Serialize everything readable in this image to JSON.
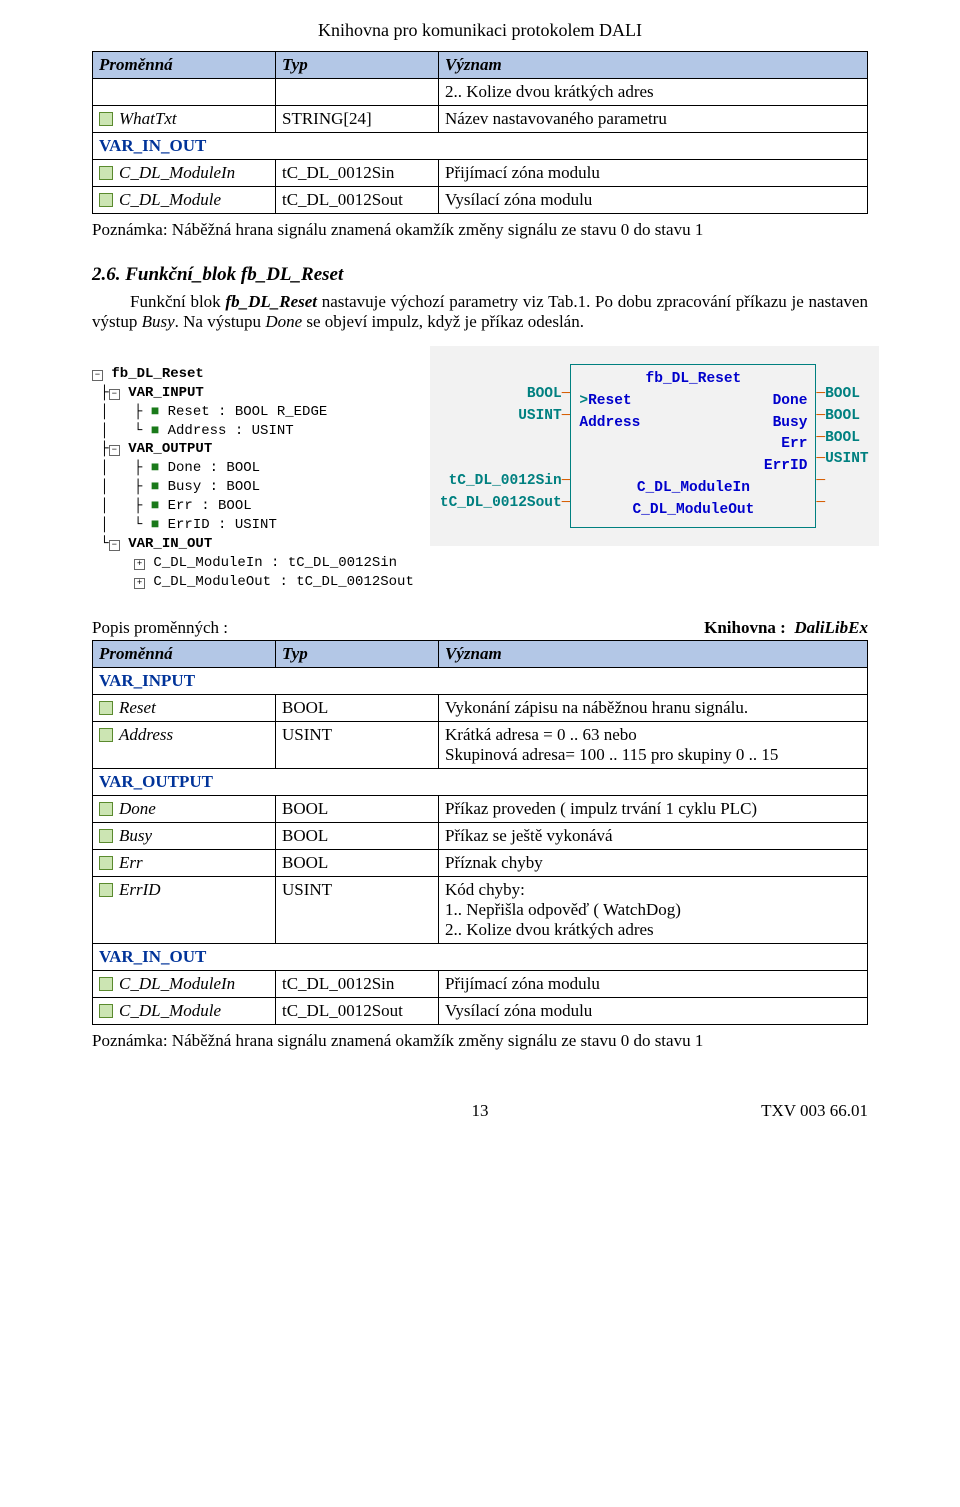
{
  "header": "Knihovna  pro komunikaci protokolem DALI",
  "tableA": {
    "th1": "Proměnná",
    "th2": "Typ",
    "th3": "Význam",
    "r1a": "",
    "r1b": "",
    "r1c": "2.. Kolize dvou krátkých adres",
    "r2a": "WhatTxt",
    "r2b": "STRING[24]",
    "r2c": "Název nastavovaného parametru",
    "sec1": "VAR_IN_OUT",
    "r3a": "C_DL_ModuleIn",
    "r3b": "tC_DL_0012Sin",
    "r3c": "Přijímací zóna modulu",
    "r4a": "C_DL_Module",
    "r4b": "tC_DL_0012Sout",
    "r4c": "Vysílací zóna modulu"
  },
  "noteA": "Poznámka: Náběžná hrana signálu znamená okamžík změny signálu ze stavu 0 do stavu 1",
  "sec26": {
    "title": "2.6.  Funkční_blok fb_DL_Reset",
    "p1": "Funkční blok fb_DL_Reset nastavuje výchozí parametry viz Tab.1. Po dobu zpracování příkazu je nastaven výstup Busy. Na výstupu Done se objeví impulz, když je příkaz odeslán."
  },
  "tree": {
    "root": "fb_DL_Reset",
    "vi": "VAR_INPUT",
    "vi1": "Reset : BOOL R_EDGE",
    "vi2": "Address : USINT",
    "vo": "VAR_OUTPUT",
    "vo1": "Done : BOOL",
    "vo2": "Busy : BOOL",
    "vo3": "Err : BOOL",
    "vo4": "ErrID : USINT",
    "vio": "VAR_IN_OUT",
    "vio1": "C_DL_ModuleIn : tC_DL_0012Sin",
    "vio2": "C_DL_ModuleOut : tC_DL_0012Sout"
  },
  "fbd": {
    "title": "fb_DL_Reset",
    "l1t": "BOOL",
    "l1p": "Reset",
    "r1p": "Done",
    "r1t": "BOOL",
    "l2t": "USINT",
    "l2p": "Address",
    "r2p": "Busy",
    "r2t": "BOOL",
    "r3p": "Err",
    "r3t": "BOOL",
    "r4p": "ErrID",
    "r4t": "USINT",
    "l5t": "tC_DL_0012Sin",
    "c5": "C_DL_ModuleIn",
    "l6t": "tC_DL_0012Sout",
    "c6": "C_DL_ModuleOut"
  },
  "descHead": {
    "left": "Popis proměnných :",
    "right_label": "Knihovna :",
    "right_val": "DaliLibEx"
  },
  "tableB": {
    "th1": "Proměnná",
    "th2": "Typ",
    "th3": "Význam",
    "sec_vi": "VAR_INPUT",
    "r1a": "Reset",
    "r1b": "BOOL",
    "r1c": "Vykonání zápisu na náběžnou hranu signálu.",
    "r2a": "Address",
    "r2b": "USINT",
    "r2c": "Krátká adresa = 0 .. 63 nebo\nSkupinová adresa= 100 .. 115 pro skupiny 0 .. 15",
    "sec_vo": "VAR_OUTPUT",
    "r3a": "Done",
    "r3b": "BOOL",
    "r3c": "Příkaz proveden ( impulz trvání 1 cyklu PLC)",
    "r4a": "Busy",
    "r4b": "BOOL",
    "r4c": "Příkaz se ještě vykonává",
    "r5a": "Err",
    "r5b": "BOOL",
    "r5c": "Příznak chyby",
    "r6a": "ErrID",
    "r6b": "USINT",
    "r6c": "Kód chyby:\n1.. Nepřišla odpověď ( WatchDog)\n2.. Kolize dvou krátkých adres",
    "sec_vio": "VAR_IN_OUT",
    "r7a": "C_DL_ModuleIn",
    "r7b": "tC_DL_0012Sin",
    "r7c": "Přijímací zóna modulu",
    "r8a": "C_DL_Module",
    "r8b": "tC_DL_0012Sout",
    "r8c": "Vysílací zóna modulu"
  },
  "noteB": "Poznámka: Náběžná hrana signálu znamená okamžík změny signálu ze stavu 0 do stavu 1",
  "footer": {
    "page": "13",
    "doc": "TXV 003 66.01"
  }
}
